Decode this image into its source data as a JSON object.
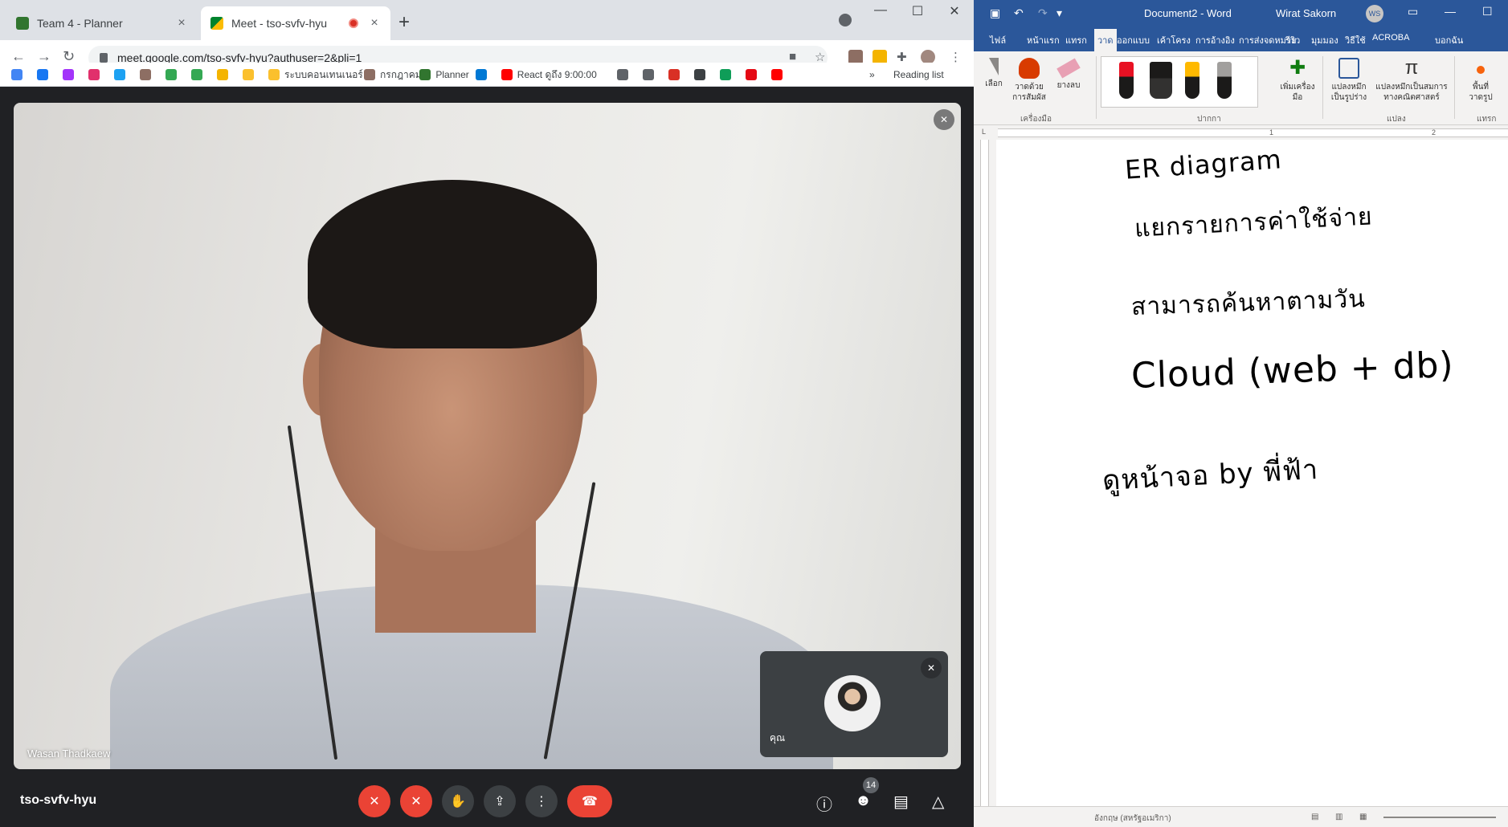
{
  "chrome": {
    "tabs": [
      {
        "title": "Team 4 - Planner",
        "close": "×"
      },
      {
        "title": "Meet - tso-svfv-hyu",
        "close": "×"
      }
    ],
    "new_tab": "+",
    "window_controls": {
      "minimize": "—",
      "maximize": "☐",
      "close": "✕"
    },
    "nav": {
      "back": "←",
      "forward": "→",
      "reload": "↻"
    },
    "url": "meet.google.com/tso-svfv-hyu?authuser=2&pli=1",
    "bookmarks": [
      {
        "label": "",
        "icon": "google-icon",
        "color": "#4285f4"
      },
      {
        "label": "",
        "icon": "facebook-icon",
        "color": "#1877f2"
      },
      {
        "label": "",
        "icon": "messenger-icon",
        "color": "#a334fa"
      },
      {
        "label": "",
        "icon": "instagram-icon",
        "color": "#e1306c"
      },
      {
        "label": "",
        "icon": "twitter-icon",
        "color": "#1da1f2"
      },
      {
        "label": "",
        "icon": "app-icon",
        "color": "#8d6e63"
      },
      {
        "label": "",
        "icon": "drive-icon",
        "color": "#34a853"
      },
      {
        "label": "",
        "icon": "drive-icon",
        "color": "#34a853"
      },
      {
        "label": "",
        "icon": "classroom-icon",
        "color": "#f4b400"
      },
      {
        "label": "",
        "icon": "folder-icon",
        "color": "#fbc02d"
      },
      {
        "label": "ระบบคอนเทนเนอร์",
        "icon": "folder-icon",
        "color": "#fbc02d"
      },
      {
        "label": "กรกฎาคม",
        "icon": "calendar-icon",
        "color": "#8d6e63"
      },
      {
        "label": "Planner",
        "icon": "planner-icon",
        "color": "#31752f"
      },
      {
        "label": "",
        "icon": "onedrive-icon",
        "color": "#0078d4"
      },
      {
        "label": "React ดูถึง 9:00:00",
        "icon": "youtube-icon",
        "color": "#ff0000"
      },
      {
        "label": "",
        "icon": "app-icon",
        "color": "#5f6368"
      },
      {
        "label": "",
        "icon": "globe-icon",
        "color": "#5f6368"
      },
      {
        "label": "",
        "icon": "record-icon",
        "color": "#d93025"
      },
      {
        "label": "",
        "icon": "app-icon",
        "color": "#3c4043"
      },
      {
        "label": "",
        "icon": "app-icon",
        "color": "#0f9d58"
      },
      {
        "label": "",
        "icon": "netflix-icon",
        "color": "#e50914"
      },
      {
        "label": "",
        "icon": "youtube-icon",
        "color": "#ff0000"
      }
    ],
    "bookmarks_more": "»",
    "reading_list": "Reading list"
  },
  "meet": {
    "main_participant": "Wasan Thadkaew",
    "self_label": "คุณ",
    "meeting_code": "tso-svfv-hyu",
    "participant_count": "14",
    "accent_red": "#ea4335"
  },
  "word": {
    "title": "Document2 - Word",
    "user": "Wirat Sakorn",
    "user_initials": "WS",
    "tabs": [
      "ไฟล์",
      "หน้าแรก",
      "แทรก",
      "วาด",
      "ออกแบบ",
      "เค้าโครง",
      "การอ้างอิง",
      "การส่งจดหมาย",
      "รีวิว",
      "มุมมอง",
      "วิธีใช้",
      "ACROBA",
      "บอกฉัน"
    ],
    "ribbon": {
      "select": "เลือก",
      "draw_touch_1": "วาดด้วย",
      "draw_touch_2": "การสัมผัส",
      "eraser": "ยางลบ",
      "group_tools": "เครื่องมือ",
      "add_pen_1": "เพิ่มเครื่อง",
      "add_pen_2": "มือ",
      "group_pens": "ปากกา",
      "ink_to_shape_1": "แปลงหมึก",
      "ink_to_shape_2": "เป็นรูปร่าง",
      "ink_to_math_1": "แปลงหมึกเป็นสมการ",
      "ink_to_math_2": "ทางคณิตศาสตร์",
      "group_convert": "แปลง",
      "canvas_1": "พื้นที่",
      "canvas_2": "วาดรูป",
      "group_insert": "แทรก"
    },
    "ruler_marks": [
      "1",
      "2"
    ],
    "ink_lines": [
      "ER diagram",
      "แยกรายการค่าใช้จ่าย",
      "สามารถค้นหาตามวัน",
      "Cloud (web + db)",
      "ดูหน้าจอ by พี่ฟ้า"
    ],
    "status_lang": "อังกฤษ (สหรัฐอเมริกา)"
  }
}
